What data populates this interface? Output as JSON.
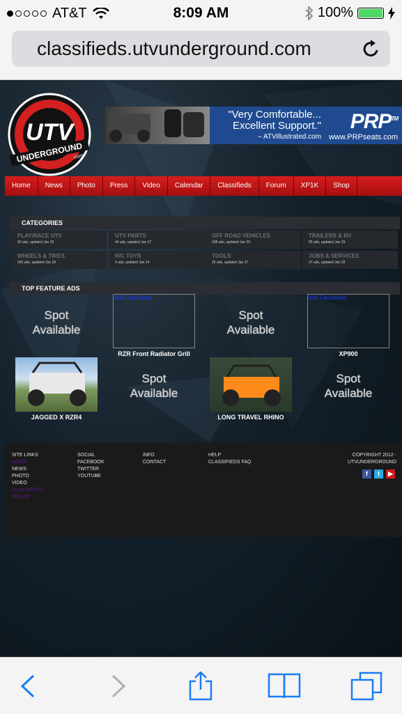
{
  "status": {
    "carrier": "AT&T",
    "time": "8:09 AM",
    "battery_pct": "100%",
    "battery_level": 1.0
  },
  "url": "classifieds.utvunderground.com",
  "logo": {
    "text": "UTV",
    "sub": "UNDERGROUND",
    "domain": ".com"
  },
  "banner": {
    "quote_line1": "\"Very Comfortable...",
    "quote_line2": "Excellent Support.\"",
    "quote_source": "– ATVillustrated.com",
    "brand": "PRP",
    "brand_tm": "TM",
    "brand_url": "www.PRPseats.com"
  },
  "nav": [
    "Home",
    "News",
    "Photo",
    "Press",
    "Video",
    "Calendar",
    "Classifieds",
    "Forum",
    "XP1K",
    "Shop"
  ],
  "categories_title": "CATEGORIES",
  "categories": [
    {
      "name": "PLAY/RACE UTV",
      "meta": "92 ads, updated Jan 29"
    },
    {
      "name": "UTV PARTS",
      "meta": "44 ads, updated Jan 27"
    },
    {
      "name": "OFF ROAD VEHICLES",
      "meta": "298 ads, updated Jan 29"
    },
    {
      "name": "TRAILERS & RV",
      "meta": "95 ads, updated Jan 29"
    },
    {
      "name": "WHEELS & TIRES",
      "meta": "200 ads, updated Jan 29"
    },
    {
      "name": "R/C TOYS",
      "meta": "4 ads, updated Jan 14"
    },
    {
      "name": "TOOLS",
      "meta": "32 ads, updated Jan 27"
    },
    {
      "name": "JOBS & SERVICES",
      "meta": "27 ads, updated Jan 29"
    }
  ],
  "feature_title": "TOP FEATURE ADS",
  "features": [
    {
      "type": "spot",
      "line1": "Spot",
      "line2": "Available"
    },
    {
      "type": "broken",
      "alt": "404 Classifieds",
      "label": "RZR Front Radiator Grill"
    },
    {
      "type": "spot",
      "line1": "Spot",
      "line2": "Available"
    },
    {
      "type": "broken",
      "alt": "404 Classifieds",
      "label": "XP900"
    },
    {
      "type": "photo",
      "label": "JAGGED X RZR4"
    },
    {
      "type": "spot",
      "line1": "Spot",
      "line2": "Available"
    },
    {
      "type": "photo",
      "label": "LONG TRAVEL RHINO"
    },
    {
      "type": "spot",
      "line1": "Spot",
      "line2": "Available"
    }
  ],
  "footer": {
    "site_links_title": "SITE LINKS",
    "site_links": [
      "HOME",
      "NEWS",
      "PHOTO",
      "VIDEO",
      "CLASSIFIEDS",
      "FORUM"
    ],
    "social_title": "SOCIAL",
    "social_links": [
      "FACEBOOK",
      "TWITTER",
      "YOUTUBE"
    ],
    "info_title": "INFO",
    "info_links": [
      "CONTACT"
    ],
    "help_title": "HELP",
    "help_links": [
      "CLASSIFIEDS FAQ"
    ],
    "copyright_line1": "COPYRIGHT 2012 -",
    "copyright_line2": "UTVUNDERGROUND",
    "social_icons": [
      "facebook-icon",
      "twitter-icon",
      "youtube-icon"
    ]
  },
  "colors": {
    "nav_red": "#c41515",
    "link_purple": "#5a1a8a",
    "broken_link_blue": "#1a3cff",
    "ios_blue": "#1a7cf5"
  }
}
